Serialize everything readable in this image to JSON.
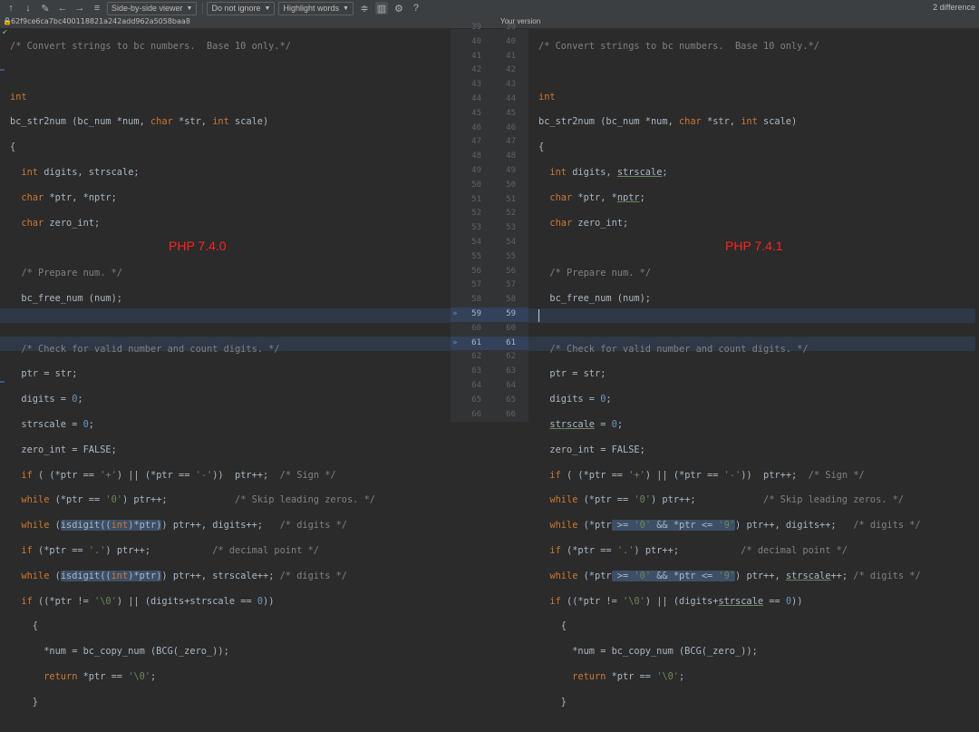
{
  "toolbar": {
    "viewer_label": "Side-by-side viewer",
    "ignore_label": "Do not ignore",
    "highlight_label": "Highlight words",
    "help_label": "?",
    "differences": "2 difference"
  },
  "path": {
    "hash": "62f9ce6ca7bc400118821a242add962a5058baa8",
    "right_title": "Your version"
  },
  "annotations": {
    "left": "PHP 7.4.0",
    "right": "PHP 7.4.1"
  },
  "gutter": {
    "left_numbers": [
      "39",
      "40",
      "41",
      "42",
      "43",
      "44",
      "45",
      "46",
      "47",
      "48",
      "49",
      "50",
      "51",
      "52",
      "53",
      "54",
      "55",
      "56",
      "57",
      "58",
      "59",
      "60",
      "61",
      "62",
      "63",
      "64",
      "65",
      "66"
    ],
    "right_numbers": [
      "39",
      "40",
      "41",
      "42",
      "43",
      "44",
      "45",
      "46",
      "47",
      "48",
      "49",
      "50",
      "51",
      "52",
      "53",
      "54",
      "55",
      "56",
      "57",
      "58",
      "59",
      "60",
      "61",
      "62",
      "63",
      "64",
      "65",
      "66"
    ],
    "arrow": "»"
  },
  "colors": {
    "background": "#2b2b2b",
    "keyword": "#cc7832",
    "comment": "#808080",
    "string": "#6a8759",
    "number": "#6897bb",
    "annotation": "#ff2222"
  }
}
